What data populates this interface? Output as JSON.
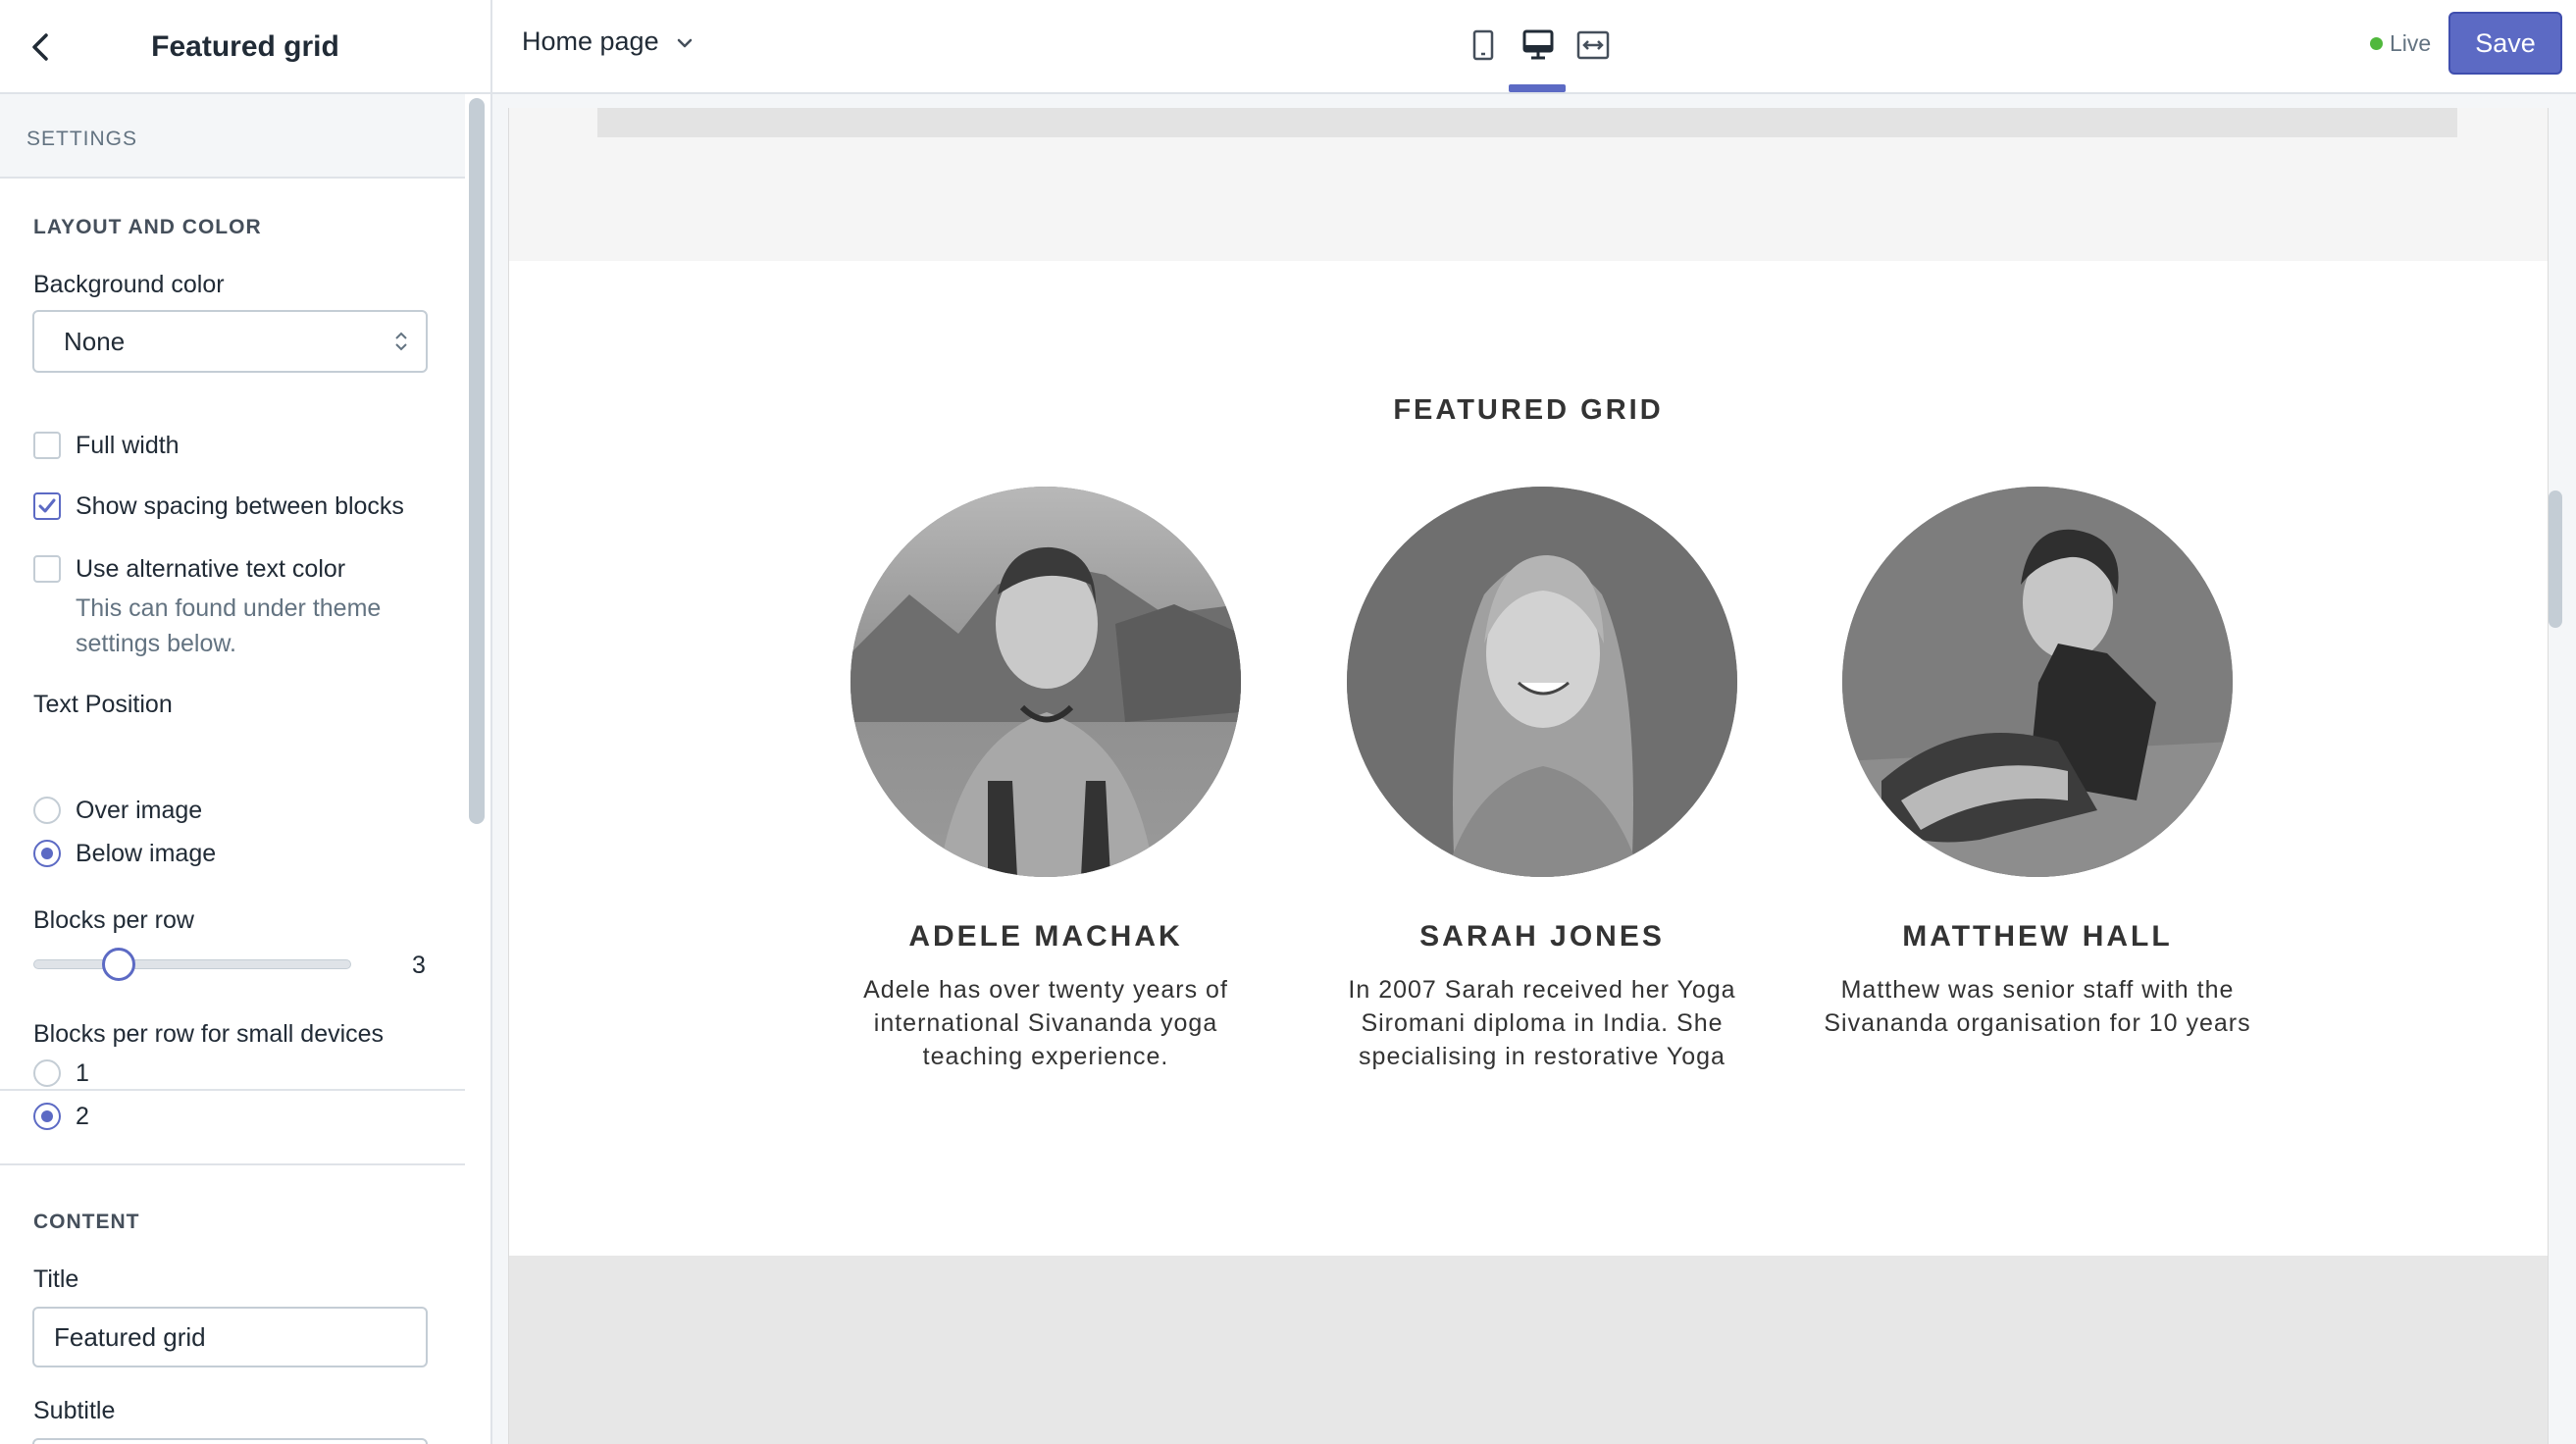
{
  "sidebar": {
    "title": "Featured grid",
    "back_icon": "chevron-left-icon",
    "settings_heading": "SETTINGS",
    "layout": {
      "heading": "LAYOUT AND COLOR",
      "background_color": {
        "label": "Background color",
        "value": "None"
      },
      "full_width": {
        "label": "Full width",
        "checked": false
      },
      "show_spacing": {
        "label": "Show spacing between blocks",
        "checked": true
      },
      "alt_text_color": {
        "label": "Use alternative text color",
        "checked": false,
        "help_line1": "This can found under theme",
        "help_line2": "settings below."
      },
      "text_position": {
        "label": "Text Position",
        "options": [
          "Over image",
          "Below image"
        ],
        "selected": "Below image"
      },
      "blocks_per_row": {
        "label": "Blocks per row",
        "value": "3",
        "min": 1,
        "max": 5
      },
      "blocks_small": {
        "label": "Blocks per row for small devices",
        "options": [
          "1",
          "2"
        ],
        "selected": "2"
      }
    },
    "content": {
      "heading": "CONTENT",
      "title_label": "Title",
      "title_value": "Featured grid",
      "subtitle_label": "Subtitle",
      "subtitle_value": ""
    }
  },
  "topbar": {
    "page_select": "Home page",
    "devices": [
      "mobile-icon",
      "desktop-icon",
      "fullscreen-icon"
    ],
    "active_device": "desktop-icon",
    "live_label": "Live",
    "live_color": "#50b83c",
    "save_label": "Save",
    "accent": "#5c6ac4"
  },
  "preview": {
    "grid_title": "FEATURED GRID",
    "people": [
      {
        "name": "ADELE MACHAK",
        "text": "Adele has over twenty years of international Sivananda yoga teaching experience."
      },
      {
        "name": "SARAH JONES",
        "text": "In 2007 Sarah received her Yoga Siromani diploma in India. She specialising in restorative Yoga"
      },
      {
        "name": "MATTHEW HALL",
        "text": "Matthew was senior staff with the Sivananda organisation for 10 years"
      }
    ]
  }
}
